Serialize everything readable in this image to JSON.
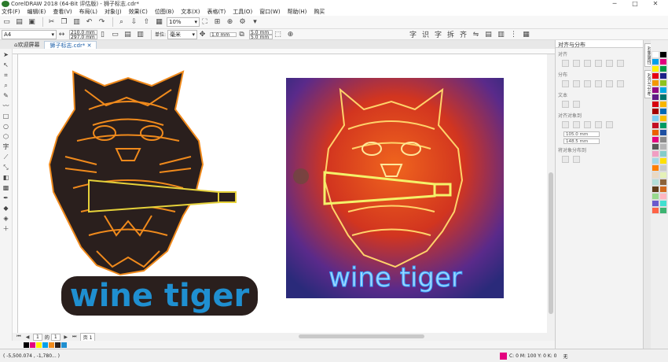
{
  "app": {
    "title": "CorelDRAW 2018 (64-Bit 评估版) - 狮子标志.cdr*",
    "window_controls": [
      "─",
      "□",
      "✕"
    ]
  },
  "menu": [
    "文件(F)",
    "编辑(E)",
    "查看(V)",
    "布局(L)",
    "对象(J)",
    "效果(C)",
    "位图(B)",
    "文本(X)",
    "表格(T)",
    "工具(O)",
    "窗口(W)",
    "帮助(H)",
    "购买"
  ],
  "toolbar": {
    "zoom": "10%"
  },
  "propbar": {
    "page_size": "A4",
    "width": "210.0 mm",
    "height": "297.0 mm",
    "units": "毫米",
    "nudge": "1.0 mm",
    "dup_x": "5.0 mm",
    "dup_y": "5.0 mm"
  },
  "tabs": {
    "home": "欢迎屏幕",
    "doc": "狮子标志.cdr*"
  },
  "canvas": {
    "tiger_text": "wine tiger",
    "neon_text": "wine tiger"
  },
  "pagebar": {
    "page_index": "1",
    "page_total": "1",
    "page_label": "页 1"
  },
  "status": {
    "coords": "( -5,500.074 , -1,780... )",
    "fill_label": "C: 0 M: 100 Y: 0 K: 0",
    "outline_label": "无"
  },
  "docker": {
    "title": "对齐与分布",
    "sec_align": "对齐",
    "sec_dist": "分布",
    "sec_text": "文本",
    "sec_object": "对齐对象到",
    "sec_spacing": "将对象分布到",
    "x_field": "105.0 mm",
    "y_field": "148.5 mm"
  },
  "dtabs": [
    "对象属性",
    "对齐与分布"
  ],
  "colors": {
    "orange": "#f08a1c",
    "dark": "#2a1f1d",
    "teal": "#1f8fd0",
    "bottle": "#e6d23a"
  },
  "palette": [
    "#ffffff",
    "#000000",
    "#00a0e9",
    "#e4007f",
    "#fff100",
    "#009944",
    "#e60012",
    "#1d2088",
    "#f39800",
    "#8fc31f",
    "#920783",
    "#00a9e0",
    "#601986",
    "#00736d",
    "#d7000f",
    "#f8b500",
    "#a40000",
    "#0068b7",
    "#7ecef4",
    "#fabe00",
    "#c30d23",
    "#009b63",
    "#eb6100",
    "#1e50a2",
    "#e4007f",
    "#8b8b8b",
    "#595757",
    "#b5b5b6",
    "#f19ec2",
    "#84ccc9",
    "#a1d8e6",
    "#ffe100",
    "#ff7f00",
    "#c9caca",
    "#ead9c3",
    "#e5f2b8",
    "#b2ddd8",
    "#8c6239",
    "#5f3c1a",
    "#d2691e",
    "#98d98e",
    "#ffb6c1",
    "#6a5acd",
    "#40e0d0",
    "#ff6347",
    "#3cb371"
  ]
}
